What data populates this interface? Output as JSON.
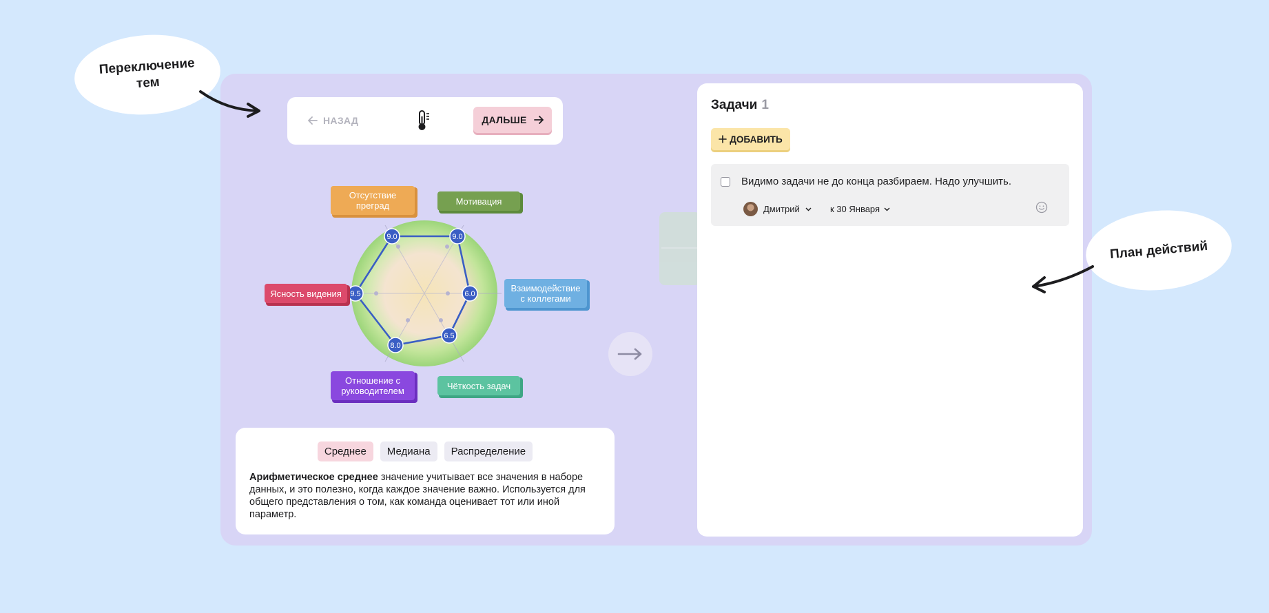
{
  "annotations": {
    "left_bubble": "Переключение тем",
    "right_bubble": "План действий"
  },
  "nav": {
    "back_label": "НАЗАД",
    "theme_icon": "thermometer-icon",
    "next_label": "ДАЛЬШЕ"
  },
  "radar": {
    "axes": [
      {
        "label": "Отсутствие преград",
        "value": "9.0",
        "color": "#eeaa55"
      },
      {
        "label": "Мотивация",
        "value": "9.0",
        "color": "#76a050"
      },
      {
        "label": "Взаимодействие с коллегами",
        "value": "6.0",
        "color": "#6fb0e2"
      },
      {
        "label": "Чёткость задач",
        "value": "6.5",
        "color": "#5cc3a0"
      },
      {
        "label": "Отношение с руководителем",
        "value": "8.0",
        "color": "#8a48df"
      },
      {
        "label": "Ясность видения",
        "value": "9.5",
        "color": "#dc4a6b"
      }
    ]
  },
  "info": {
    "tabs": [
      "Среднее",
      "Медиана",
      "Распределение"
    ],
    "active_tab": "Среднее",
    "text_bold": "Арифметическое среднее",
    "text_rest": " значение учитывает все значения в наборе данных, и это полезно, когда каждое значение важно. Используется для общего представления о том, как команда оценивает тот или иной параметр."
  },
  "tasks": {
    "title": "Задачи",
    "count": "1",
    "add_label": "ДОБАВИТЬ",
    "items": [
      {
        "text": "Видимо задачи не до конца разбираем. Надо улучшить.",
        "assignee": "Дмитрий",
        "due": "к 30 Января"
      }
    ]
  }
}
